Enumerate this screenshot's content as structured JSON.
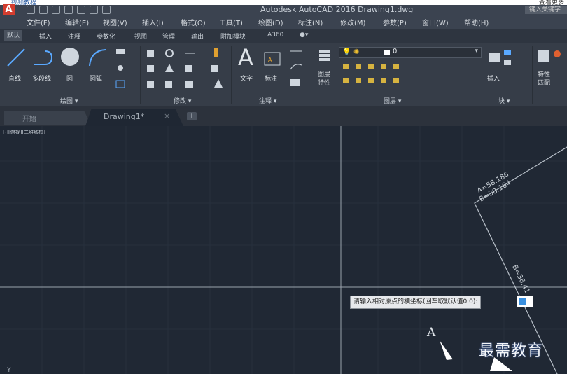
{
  "top_strip": {
    "left_text": "视频教程",
    "right_text": "查看更多"
  },
  "logo": {
    "letter": "A"
  },
  "app": {
    "title": "Autodesk AutoCAD 2016   Drawing1.dwg",
    "search_text": "键入关键字"
  },
  "menu": [
    "文件(F)",
    "编辑(E)",
    "视图(V)",
    "插入(I)",
    "格式(O)",
    "工具(T)",
    "绘图(D)",
    "标注(N)",
    "修改(M)",
    "参数(P)",
    "窗口(W)",
    "帮助(H)"
  ],
  "ribbon_tabs": [
    "默认",
    "插入",
    "注释",
    "参数化",
    "视图",
    "管理",
    "输出",
    "附加模块",
    "A360",
    "●▾"
  ],
  "ribbon": {
    "draw": {
      "line": "直线",
      "polyline": "多段线",
      "circle": "圆",
      "arc": "圆弧",
      "footer": "绘图 ▾"
    },
    "modify": {
      "footer": "修改 ▾"
    },
    "annotation": {
      "text": "文字",
      "dimension": "标注",
      "footer": "注释 ▾"
    },
    "layers": {
      "props": "图层\n特性",
      "layer_value": "0",
      "footer": "图层 ▾"
    },
    "block": {
      "insert": "插入",
      "footer": "块 ▾"
    },
    "properties": {
      "match": "特性\n匹配"
    }
  },
  "doc_tabs": {
    "start": "开始",
    "drawing": "Drawing1*",
    "close": "×",
    "new": "+"
  },
  "canvas": {
    "viewport_label": "[-][俯视][二维线框]",
    "dim_a": "A=58.186",
    "dim_b": "B=38.164",
    "dim_c": "B=36.41",
    "point_label": "A",
    "command_prompt": "请输入相对原点的横坐标(回车取默认值0.0):",
    "ucs": "Y"
  },
  "watermark": "最需教育",
  "colors": {
    "canvas_bg": "#202834",
    "ribbon_bg": "#363d48",
    "accent": "#3a90e0"
  }
}
